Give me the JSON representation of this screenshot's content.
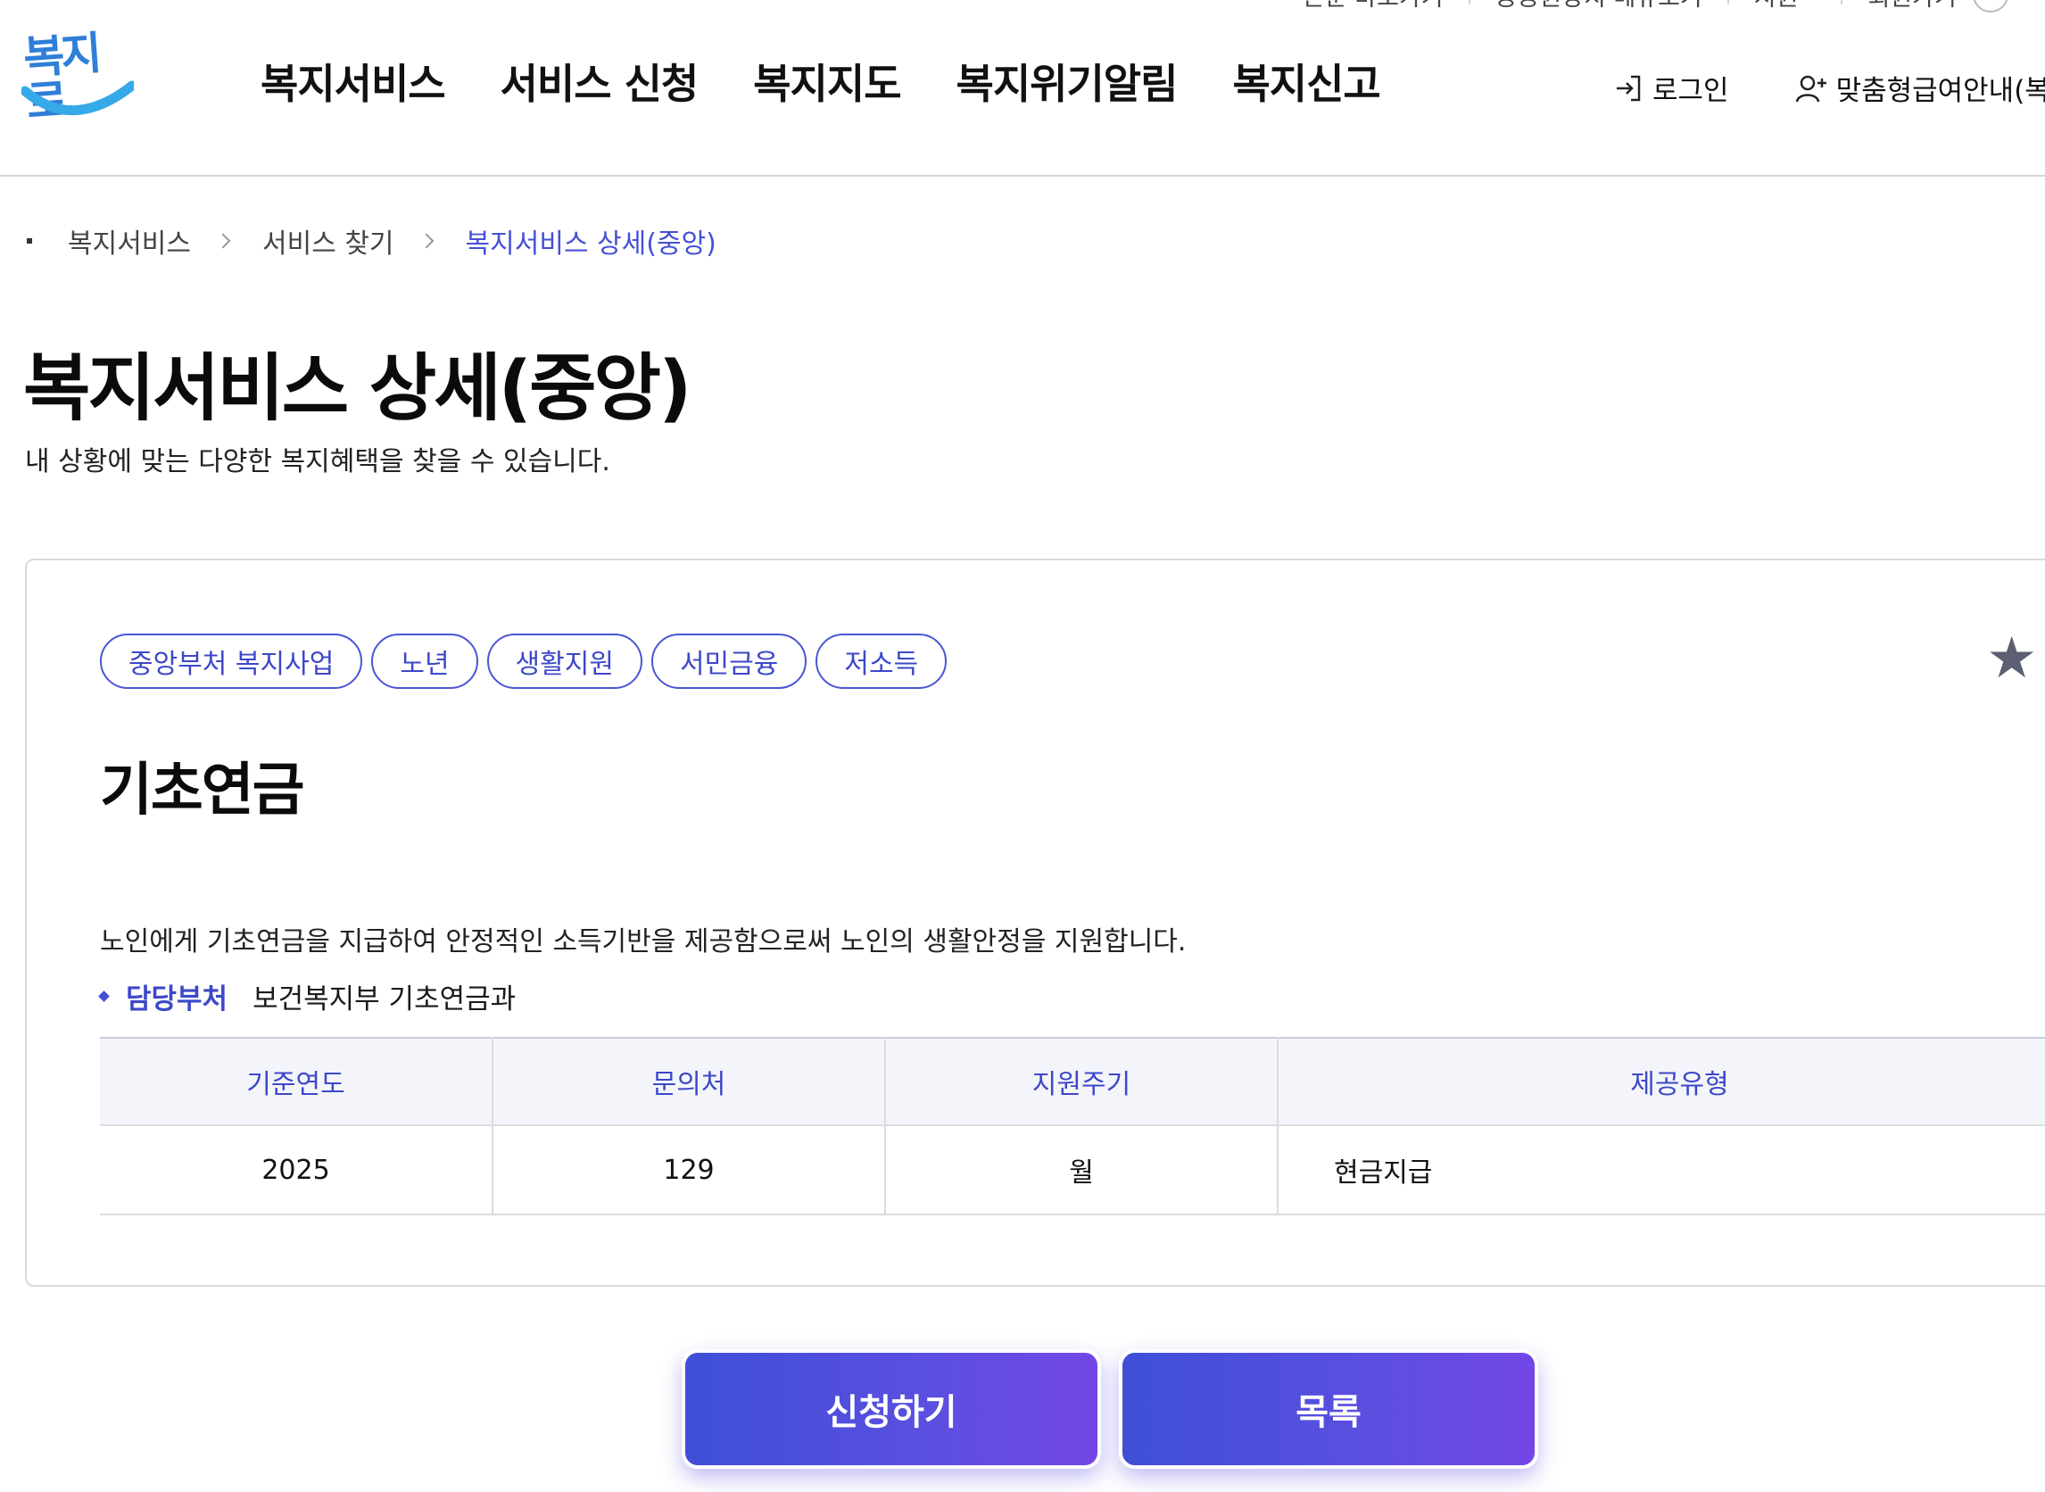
{
  "utility": {
    "items": [
      "본문 바로가기",
      "공공원장치 메뉴보기",
      "지원",
      "회원가기"
    ]
  },
  "logo": {
    "text": "복지로"
  },
  "gnb": {
    "items": [
      "복지서비스",
      "서비스 신청",
      "복지지도",
      "복지위기알림",
      "복지신고"
    ]
  },
  "header_actions": {
    "login": "로그인",
    "custom": "맞춤형급여안내(복"
  },
  "breadcrumb": {
    "items": [
      "복지서비스",
      "서비스 찾기"
    ],
    "current": "복지서비스 상세(중앙)"
  },
  "page": {
    "title": "복지서비스 상세(중앙)",
    "subtitle": "내 상황에 맞는 다양한 복지혜택을 찾을 수 있습니다."
  },
  "service": {
    "tags": [
      "중앙부처 복지사업",
      "노년",
      "생활지원",
      "서민금융",
      "저소득"
    ],
    "favorite_icon": "★",
    "title": "기초연금",
    "description": "노인에게 기초연금을 지급하여 안정적인 소득기반을 제공함으로써 노인의 생활안정을 지원합니다.",
    "dept_label": "담당부처",
    "dept_value": "보건복지부 기초연금과",
    "table": {
      "headers": [
        "기준연도",
        "문의처",
        "지원주기",
        "제공유형"
      ],
      "row": [
        "2025",
        "129",
        "월",
        "현금지급"
      ]
    }
  },
  "buttons": {
    "apply": "신청하기",
    "list": "목록"
  },
  "colors": {
    "accent": "#4450d4",
    "logo": "#2f7fd8",
    "button_gradient_start": "#3f4fd6",
    "button_gradient_end": "#7346e6"
  }
}
